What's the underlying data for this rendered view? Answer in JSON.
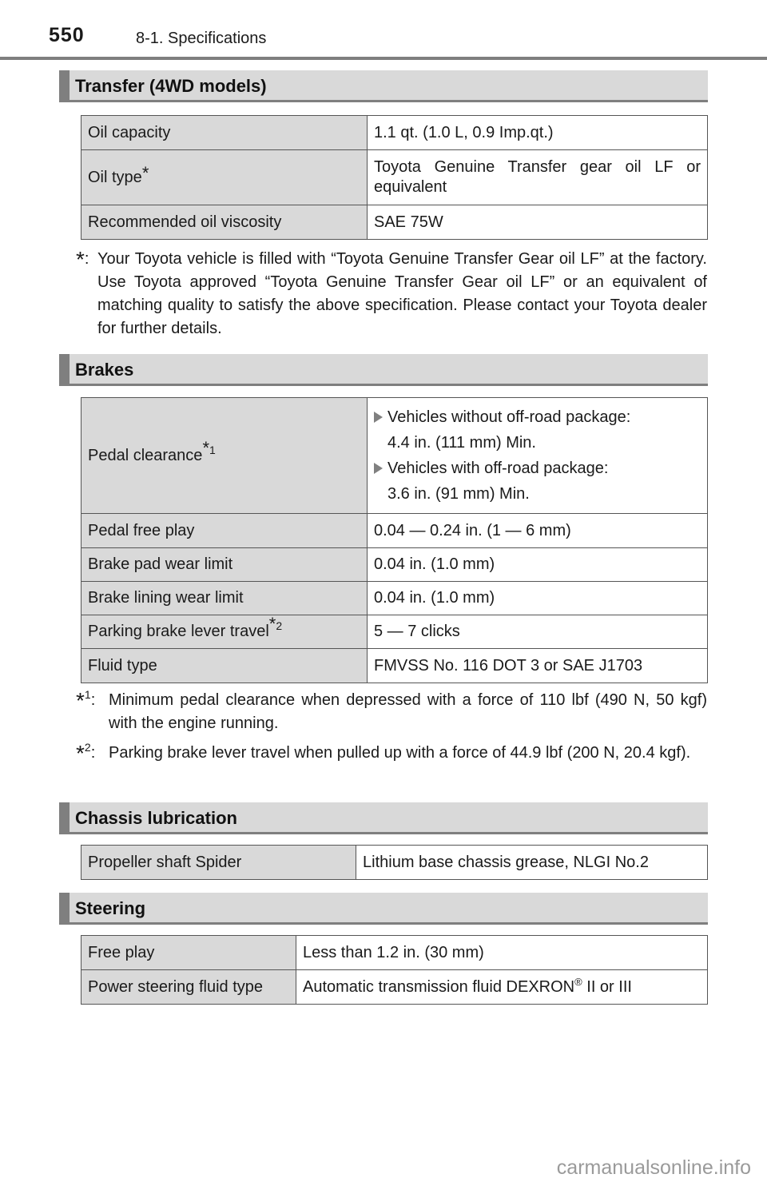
{
  "header": {
    "page_number": "550",
    "section_title": "8-1. Specifications"
  },
  "transfer": {
    "heading": "Transfer (4WD models)",
    "rows": [
      {
        "key": "Oil capacity",
        "key_sup": "",
        "value": "1.1 qt. (1.0 L, 0.9 Imp.qt.)"
      },
      {
        "key": "Oil type",
        "key_sup": "*",
        "value": "Toyota Genuine Transfer gear oil LF or equivalent"
      },
      {
        "key": "Recommended oil viscosity",
        "key_sup": "",
        "value": "SAE 75W"
      }
    ],
    "note": {
      "marker": "*",
      "text": "Your Toyota vehicle is filled with “Toyota Genuine Transfer Gear oil LF” at the factory. Use Toyota approved “Toyota Genuine Transfer Gear oil LF” or an equivalent of matching quality to satisfy the above specification. Please contact your Toyota dealer for further details."
    }
  },
  "brakes": {
    "heading": "Brakes",
    "pedal_clearance": {
      "key": "Pedal clearance",
      "key_sup": "1",
      "items": [
        {
          "label": "Vehicles without off-road package:",
          "value": "4.4 in. (111 mm) Min."
        },
        {
          "label": "Vehicles with off-road package:",
          "value": "3.6 in. (91 mm) Min."
        }
      ]
    },
    "rows": [
      {
        "key": "Pedal free play",
        "key_sup": "",
        "value": "0.04 — 0.24 in. (1 — 6 mm)"
      },
      {
        "key": "Brake pad wear limit",
        "key_sup": "",
        "value": "0.04 in. (1.0 mm)"
      },
      {
        "key": "Brake lining wear limit",
        "key_sup": "",
        "value": "0.04 in. (1.0 mm)"
      },
      {
        "key": "Parking brake lever travel",
        "key_sup": "2",
        "value": "5 — 7 clicks"
      },
      {
        "key": "Fluid type",
        "key_sup": "",
        "value": "FMVSS No. 116 DOT 3 or SAE J1703"
      }
    ],
    "notes": [
      {
        "marker": "1",
        "text": "Minimum pedal clearance when depressed with a force of 110 lbf (490 N, 50 kgf) with the engine running."
      },
      {
        "marker": "2",
        "text": "Parking brake lever travel when pulled up with a force of 44.9 lbf (200 N, 20.4 kgf)."
      }
    ]
  },
  "chassis": {
    "heading": "Chassis lubrication",
    "rows": [
      {
        "key": "Propeller shaft Spider",
        "value": "Lithium base chassis grease, NLGI No.2"
      }
    ]
  },
  "steering": {
    "heading": "Steering",
    "rows": [
      {
        "key": "Free play",
        "value": "Less than 1.2 in. (30 mm)"
      },
      {
        "key": "Power steering fluid type",
        "value_pre": "Automatic transmission fluid DEXRON",
        "value_reg": "®",
        "value_post": " II or III"
      }
    ]
  },
  "watermark": "carmanualsonline.info",
  "colors": {
    "heading_bg": "#d9d9d9",
    "accent_gray": "#7f7f7f",
    "key_cell_bg": "#d9d9d9"
  }
}
